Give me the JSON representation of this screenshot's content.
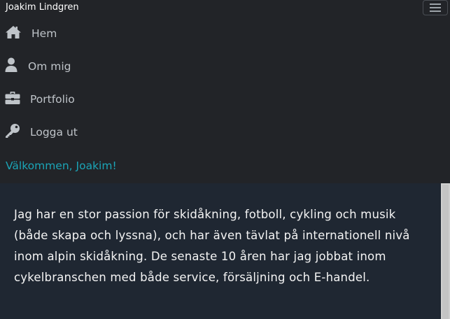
{
  "navbar": {
    "brand": "Joakim Lindgren",
    "toggler_icon": "hamburger-menu-icon",
    "items": [
      {
        "label": "Hem",
        "icon": "home-icon"
      },
      {
        "label": "Om mig",
        "icon": "user-icon"
      },
      {
        "label": "Portfolio",
        "icon": "briefcase-icon"
      },
      {
        "label": "Logga ut",
        "icon": "key-icon"
      }
    ],
    "welcome": "Välkommen, Joakim!"
  },
  "main": {
    "text": "Jag har en stor passion för skidåkning, fotboll, cykling och musik (både skapa och lyssna), och har även tävlat på internationell nivå inom alpin skidåkning. De senaste 10 åren har jag jobbat inom cykelbranschen med både service, försäljning och E-handel."
  },
  "colors": {
    "navbar_bg": "#222428",
    "content_bg": "#1f2732",
    "nav_text": "#bfc4c9",
    "accent": "#1ba5b7"
  }
}
